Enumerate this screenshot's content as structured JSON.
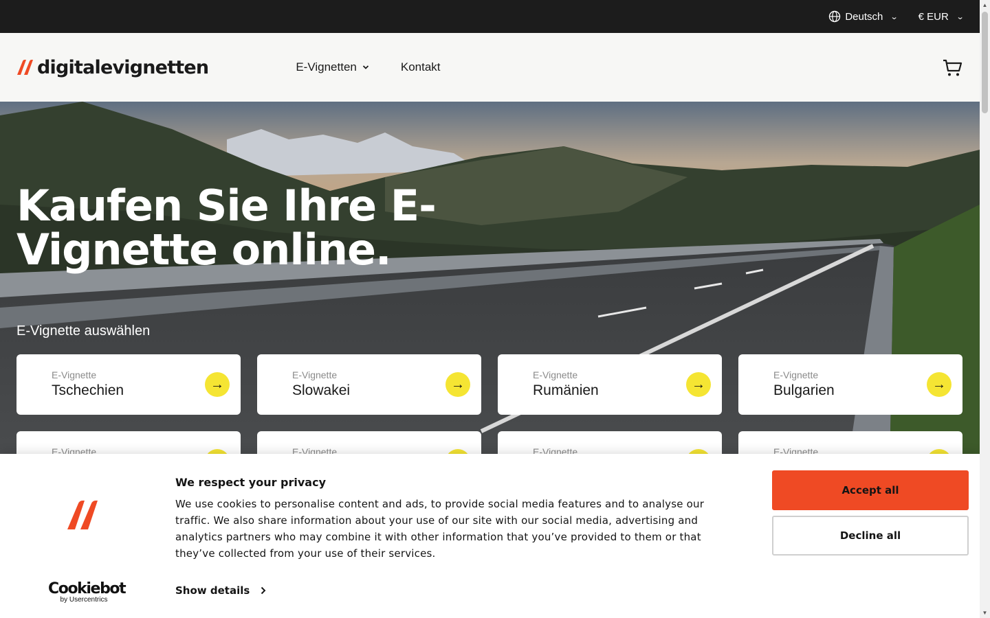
{
  "topbar": {
    "language": "Deutsch",
    "currency": "€ EUR"
  },
  "header": {
    "logo_text": "digitalevignetten",
    "nav": [
      {
        "label": "E-Vignetten"
      },
      {
        "label": "Kontakt"
      }
    ]
  },
  "hero": {
    "title": "Kaufen Sie Ihre E-Vignette online.",
    "subtitle": "E-Vignette auswählen"
  },
  "cards": [
    {
      "kicker": "E-Vignette",
      "title": "Tschechien"
    },
    {
      "kicker": "E-Vignette",
      "title": "Slowakei"
    },
    {
      "kicker": "E-Vignette",
      "title": "Rumänien"
    },
    {
      "kicker": "E-Vignette",
      "title": "Bulgarien"
    },
    {
      "kicker": "E-Vignette",
      "title": ""
    },
    {
      "kicker": "E-Vignette",
      "title": ""
    },
    {
      "kicker": "E-Vignette",
      "title": ""
    },
    {
      "kicker": "E-Vignette",
      "title": ""
    }
  ],
  "cookie": {
    "title": "We respect your privacy",
    "text": "We use cookies to personalise content and ads, to provide social media features and to analyse our traffic. We also share information about your use of our site with our social media, advertising and analytics partners who may combine it with other information that you’ve provided to them or that they’ve collected from your use of their services.",
    "show_details": "Show details",
    "accept": "Accept all",
    "decline": "Decline all",
    "brand": "Cookiebot",
    "brand_sub": "by Usercentrics"
  },
  "colors": {
    "accent": "#ef4a24",
    "card_arrow": "#f5e533",
    "topbar": "#1c1c1c"
  },
  "icons": {
    "globe": "globe-icon",
    "cart": "cart-icon",
    "arrow": "arrow-right-icon",
    "chevron": "chevron-down-icon"
  }
}
